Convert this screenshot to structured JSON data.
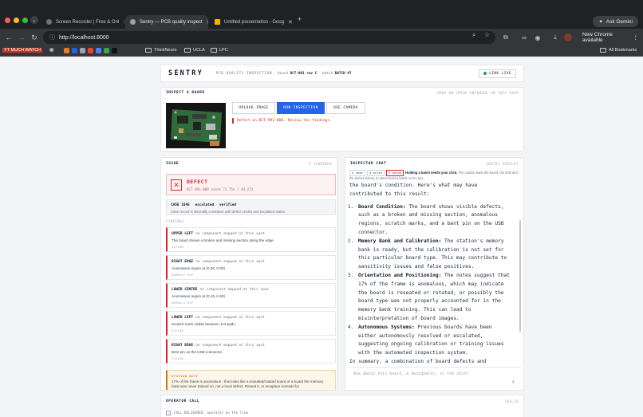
{
  "browser": {
    "tabs": [
      {
        "title": "Screen Recorder | Free & Onl",
        "active": false
      },
      {
        "title": "Sentry — PCB quality inspect",
        "active": true
      },
      {
        "title": "Untitled presentation - Goog",
        "active": false
      }
    ],
    "new_tab": "+",
    "ask_gemini": "Ask Gemini",
    "url": "http://localhost:8000",
    "update_label": "New Chrome available",
    "bookmarks": [
      {
        "label": "YT MUCH WATCH"
      },
      {
        "label": "ThinkNeuro"
      },
      {
        "label": "UCLA"
      },
      {
        "label": "LPC"
      }
    ],
    "all_bookmarks": "All Bookmarks"
  },
  "header": {
    "logo": "SENTRY",
    "subtitle": "PCB QUALITY INSPECTION",
    "board_label": "board",
    "board_value": "DCT-991 rev C",
    "batch_label": "batch",
    "batch_value": "BATCH 47",
    "link_live": "LINK LIVE"
  },
  "inspect": {
    "title": "INSPECT A BOARD",
    "hint": "DROP AN IMAGE ANYWHERE ON THIS PAGE",
    "upload": "UPLOAD IMAGE",
    "run": "RUN INSPECTION",
    "camera": "USE CAMERA",
    "alert": "Defect on DCT-991-008. Review the findings."
  },
  "issue": {
    "title": "ISSUE",
    "count": "5 FINDINGS",
    "defect_title": "DEFECT",
    "defect_meta": "DCT-991-008 score 73.75s / 44.272",
    "case_id": "CASE 1045",
    "case_status_1": "escalated",
    "case_status_2": "verified",
    "case_note": "Case record is internally consistent with defect verdict and escalated status.",
    "findings_label": "FINDINGS",
    "findings": [
      {
        "title": "UPPER LEFT",
        "sub": "no component mapped at this spot",
        "desc": "The board shows a broken and missing section along the edge.",
        "tag": "VISION"
      },
      {
        "title": "RIGHT EDGE",
        "sub": "no component mapped at this spot",
        "desc": "Anomalous region at (0.36, 0.90)",
        "tag": "ANOMALY MAP"
      },
      {
        "title": "LOWER CENTRE",
        "sub": "no component mapped at this spot",
        "desc": "Anomalous region at (0.15, 0.60)",
        "tag": "ANOMALY MAP"
      },
      {
        "title": "LOWER LEFT",
        "sub": "no component mapped at this spot",
        "desc": "Scratch mark visible between J13 pads.",
        "tag": "VISION"
      },
      {
        "title": "RIGHT EDGE",
        "sub": "no component mapped at this spot",
        "desc": "Bent pin on the USB connector.",
        "tag": "VISION"
      }
    ],
    "station_note_label": "STATION NOTE",
    "station_note": "17% of the frame is anomalous - this looks like a reseated/rotated board or a board the memory bank was never trained on, not a local defect. Reseat it, or recapture normals for"
  },
  "chat": {
    "title": "INSPECTOR CHAT",
    "model": "SENTRY COPILOT",
    "chips": [
      "4 case",
      "4 write",
      "3 gated"
    ],
    "chip_note_bold": "Holding a batch needs your click.",
    "chip_note": "The copilot reads the board, the shift and the defect history. It cannot hold a batch on its own.",
    "intro": "the board's condition. Here's what may have contributed to this result:",
    "items": [
      {
        "bold": "Board Condition:",
        "text": " The board shows visible defects, such as a broken and missing section, anomalous regions, scratch marks, and a bent pin on the USB connector."
      },
      {
        "bold": "Memory Bank and Calibration:",
        "text": " The station's memory bank is ready, but the calibration is not set for this particular board type. This may contribute to sensitivity issues and false positives."
      },
      {
        "bold": "Orientation and Positioning:",
        "text": " The notes suggest that 17% of the frame is anomalous, which may indicate the board is reseated or rotated, or possibly the board type was not properly accounted for in the memory bank training. This can lead to misinterpretation of board images."
      },
      {
        "bold": "Autonomous Systems:",
        "text": " Previous boards have been either autonomously resolved or escalated, suggesting ongoing calibration or training issues with the automated inspection system."
      }
    ],
    "summary": "In summary, a combination of board defects and",
    "placeholder": "Ask about this board, a designator, or the shift",
    "send_icon": "↑"
  },
  "operator": {
    "title": "OPERATOR CALL",
    "status": "TWILIO",
    "item": "CALL DELIVERED: operator on the line"
  },
  "colors": {
    "accent": "#2563eb",
    "danger": "#dc2626",
    "live": "#16a34a",
    "warn": "#d97706"
  }
}
